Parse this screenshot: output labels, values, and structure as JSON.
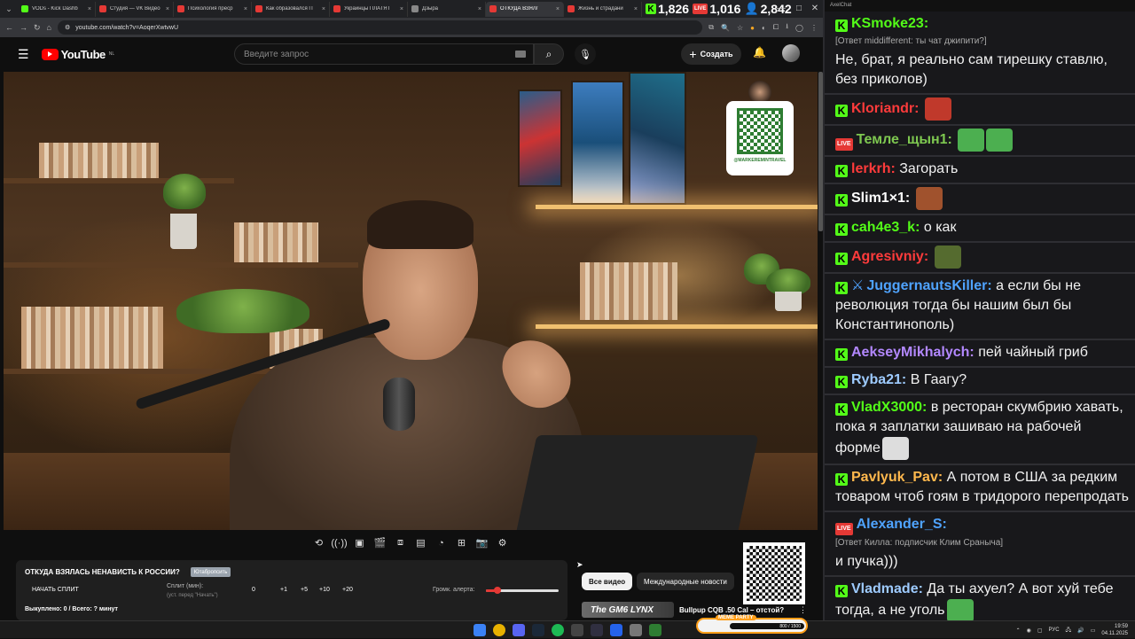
{
  "browser": {
    "tabs": [
      {
        "label": "VODs - Kick Dashb",
        "color": "#53fc18"
      },
      {
        "label": "Студия — VK Видео",
        "color": "#e53935"
      },
      {
        "label": "Психология преср",
        "color": "#e53935"
      },
      {
        "label": "Как образовался П",
        "color": "#e53935"
      },
      {
        "label": "Украинцы ПЛАТЯТ",
        "color": "#e53935"
      },
      {
        "label": "Дзыра",
        "color": "#888888"
      },
      {
        "label": "ОТКУДА ВЗЯЛ/",
        "color": "#e53935",
        "active": true
      },
      {
        "label": "Жизнь и страдани",
        "color": "#e53935"
      }
    ],
    "url": "youtube.com/watch?v=AoqerXwtvwU",
    "tab_menu_icon": "chevron-down-icon",
    "tab_close": "×",
    "new_tab": "+"
  },
  "stats": {
    "kick_viewers": "1,826",
    "live_viewers": "1,016",
    "total_viewers": "2,842",
    "live_label": "LIVE"
  },
  "window": {
    "minimize": "—",
    "maximize": "□",
    "close": "✕"
  },
  "youtube": {
    "logo": "YouTube",
    "region": "NL",
    "search_placeholder": "Введите запрос",
    "create_label": "Создать",
    "qr_handle": "@MARKEREMINTRAVEL"
  },
  "split": {
    "title": "ОТКУДА ВЗЯЛАСЬ НЕНАВИСТЬ К РОССИИ?",
    "badge": "Ютабропсить",
    "start_label": "НАЧАТЬ СПЛИТ",
    "split_label": "Сплит (мин):",
    "split_hint": "(уст. перед \"Начать\")",
    "value": "0",
    "steps": [
      "+1",
      "+5",
      "+10",
      "+20"
    ],
    "alert_label": "Громк. алерта:",
    "alert_volume": 0.14,
    "bought": "Выкуплено: 0 / Всего: ? минут"
  },
  "chips": {
    "all": "Все видео",
    "intl": "Международные новости"
  },
  "related": {
    "thumb_text": "The GM6 LYNX",
    "title": "Bullpup CQB .50 Cal – отстой?"
  },
  "chat": {
    "header": "AxelChat",
    "messages": [
      {
        "platform": "kick",
        "user": "KSmoke23:",
        "color": "#53fc18",
        "reply": "[Ответ middifferent: ты чат джипити?]",
        "text": "Не, брат, я реально сам тирешку ставлю, без приколов)"
      },
      {
        "platform": "kick",
        "user": "Kloriandr:",
        "color": "#ff3b3b",
        "text": "",
        "emotes": [
          "#c0392b"
        ]
      },
      {
        "platform": "live",
        "user": "Темле_щын1:",
        "color": "#7ec850",
        "text": "",
        "emotes": [
          "#4caf50",
          "#4caf50"
        ]
      },
      {
        "platform": "kick",
        "user": "lerkrh:",
        "color": "#ff3b3b",
        "text": "Загорать"
      },
      {
        "platform": "kick",
        "user": "Slim1×1:",
        "color": "#ffffff",
        "text": "",
        "emotes": [
          "#a0522d"
        ]
      },
      {
        "platform": "kick",
        "user": "cah4e3_k:",
        "color": "#53fc18",
        "text": "о как"
      },
      {
        "platform": "kick",
        "user": "Agresivniy:",
        "color": "#ff3b3b",
        "text": "",
        "emotes": [
          "#556b2f"
        ]
      },
      {
        "platform": "kick",
        "user": "JuggernautsKiller:",
        "color": "#4fa3ff",
        "badge": "sword-icon",
        "text": "а если бы не революция тогда бы нашим был бы Константинополь)"
      },
      {
        "platform": "kick",
        "user": "AekseyMikhalych:",
        "color": "#b388ff",
        "text": "пей чайный гриб"
      },
      {
        "platform": "kick",
        "user": "Ryba21:",
        "color": "#9ecbff",
        "text": "В Гаагу?"
      },
      {
        "platform": "kick",
        "user": "VladX3000:",
        "color": "#53fc18",
        "text": "в ресторан скумбрию хавать, пока я заплатки зашиваю на рабочей форме",
        "emotes": [
          "#dddddd"
        ]
      },
      {
        "platform": "kick",
        "user": "Pavlyuk_Pav:",
        "color": "#ffb84d",
        "text": "А потом в США за редким товаром чтоб гоям в тридорого перепродать"
      },
      {
        "platform": "live",
        "user": "Alexander_S:",
        "color": "#4fa3ff",
        "reply": "[Ответ Килла: подписчик Клим Сраныча]",
        "text": "и пучка)))"
      },
      {
        "platform": "kick",
        "user": "Vladmade:",
        "color": "#9ecbff",
        "text": "Да ты ахуел? А вот хуй тебе тогда, а не уголь",
        "emotes": [
          "#4caf50"
        ]
      }
    ]
  },
  "taskbar": {
    "meme_tag": "MEME PARTY",
    "meme_progress": "800 / 1500",
    "lang": "РУС",
    "time": "19:59",
    "date": "04.11.2025"
  }
}
